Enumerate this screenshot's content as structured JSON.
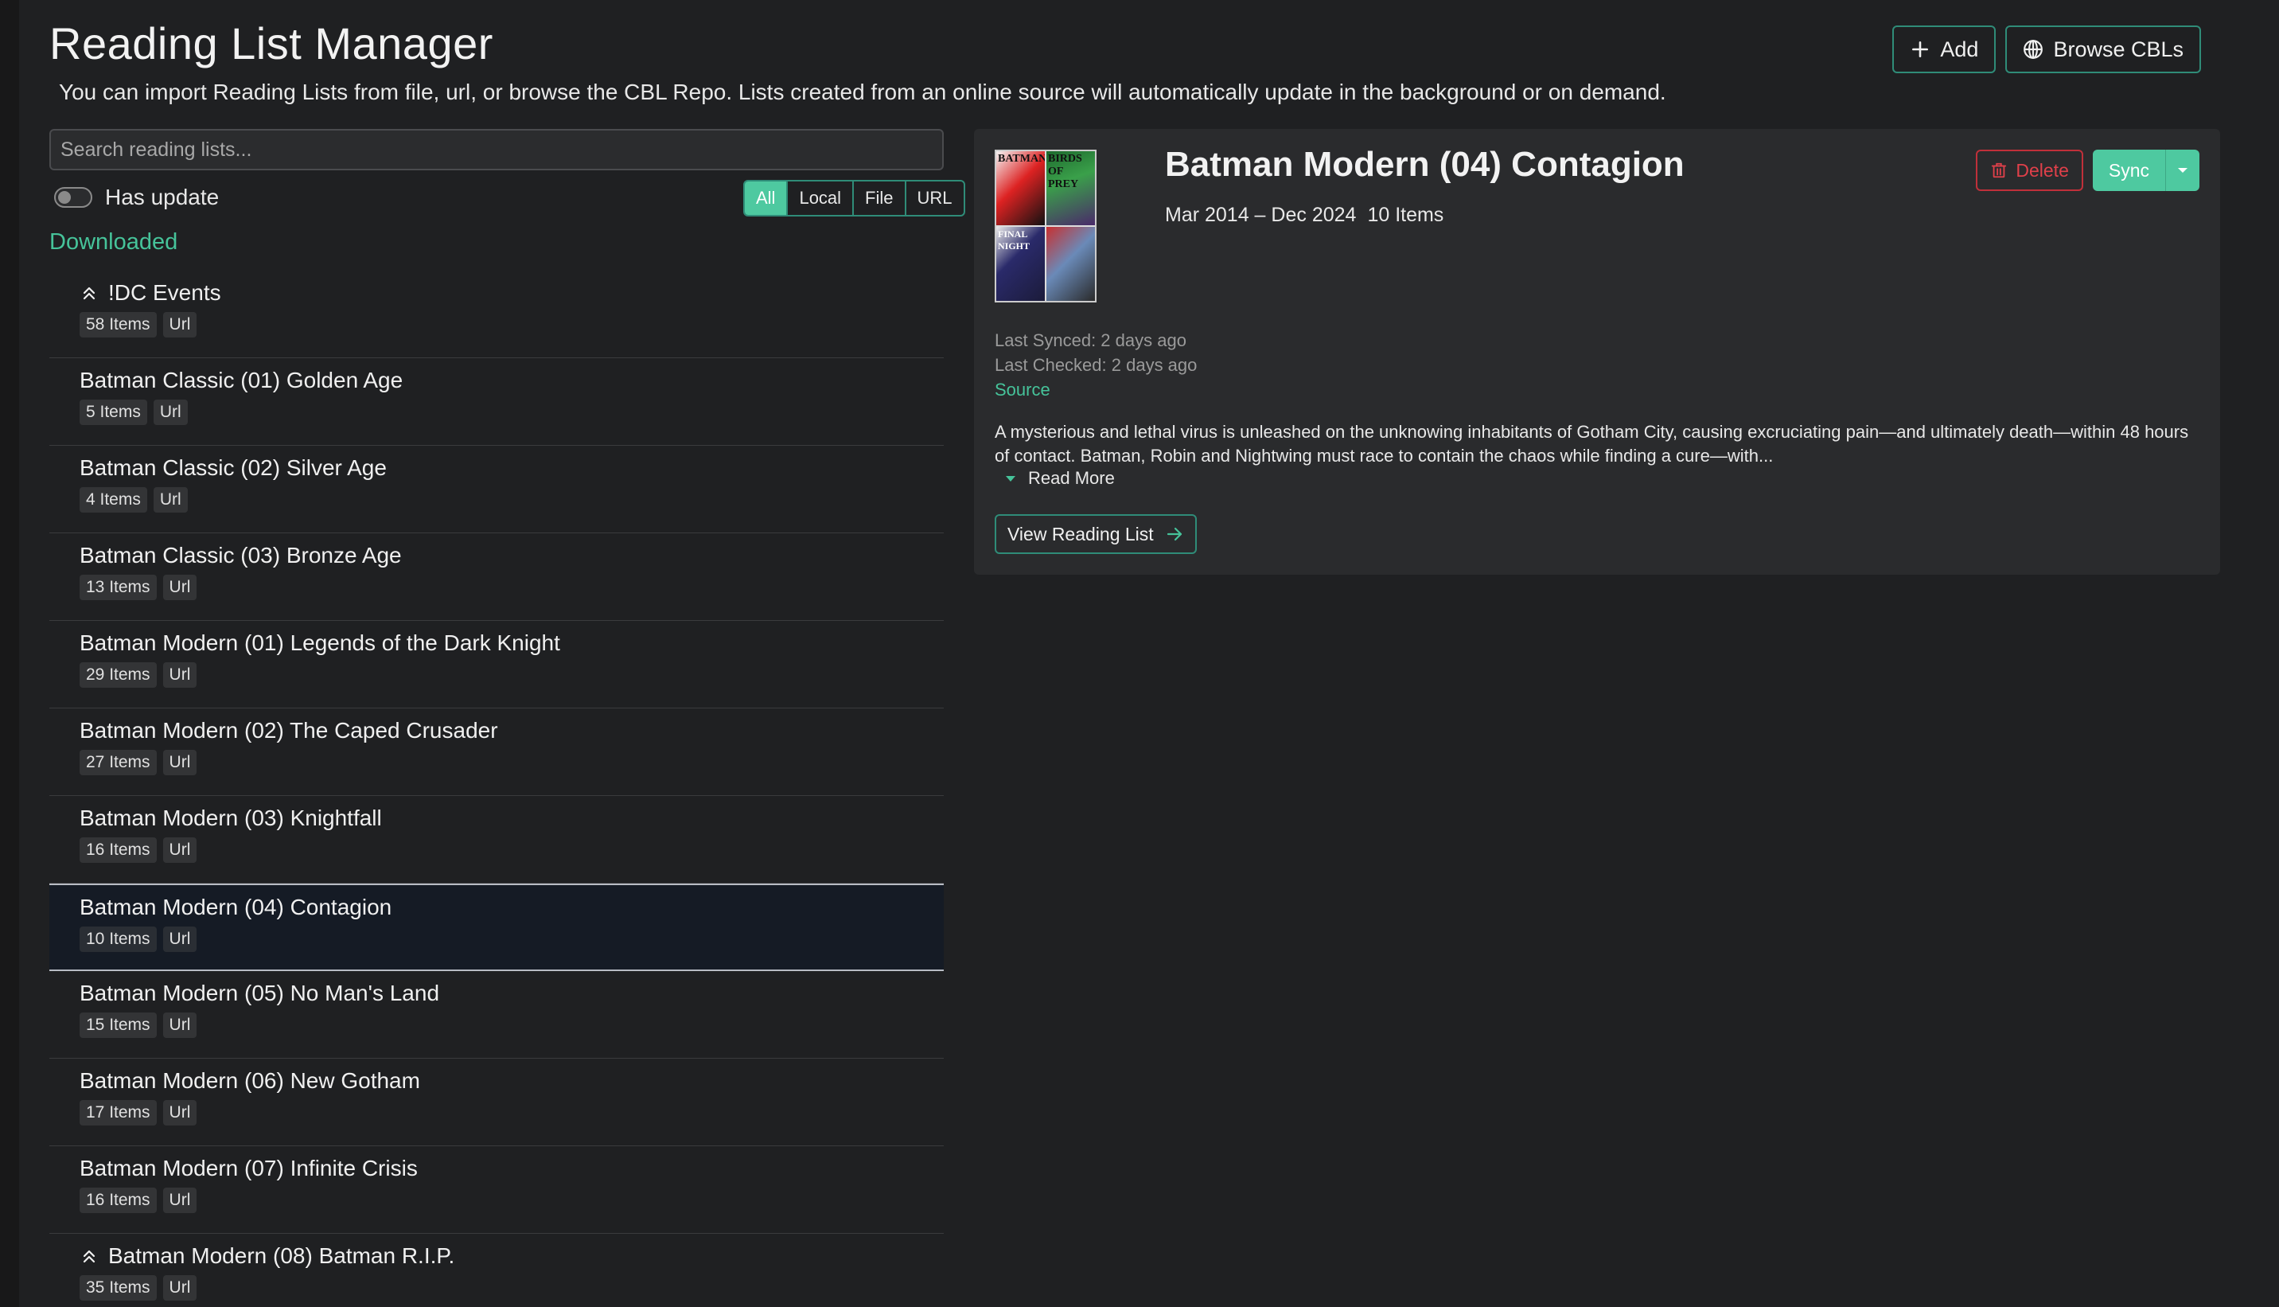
{
  "header": {
    "title": "Reading List Manager",
    "description": "You can import Reading Lists from file, url, or browse the CBL Repo. Lists created from an online source will automatically update in the background or on demand.",
    "add_label": "Add",
    "browse_label": "Browse CBLs"
  },
  "search": {
    "placeholder": "Search reading lists..."
  },
  "filters": {
    "has_update_label": "Has update",
    "has_update_on": false,
    "options": [
      "All",
      "Local",
      "File",
      "URL"
    ],
    "active": "All"
  },
  "section_label": "Downloaded",
  "list": [
    {
      "title": "!DC Events",
      "collapsible": true,
      "count": "58 Items",
      "source": "Url",
      "selected": false
    },
    {
      "title": "Batman Classic (01) Golden Age",
      "collapsible": false,
      "count": "5 Items",
      "source": "Url",
      "selected": false
    },
    {
      "title": "Batman Classic (02) Silver Age",
      "collapsible": false,
      "count": "4 Items",
      "source": "Url",
      "selected": false
    },
    {
      "title": "Batman Classic (03) Bronze Age",
      "collapsible": false,
      "count": "13 Items",
      "source": "Url",
      "selected": false
    },
    {
      "title": "Batman Modern (01) Legends of the Dark Knight",
      "collapsible": false,
      "count": "29 Items",
      "source": "Url",
      "selected": false
    },
    {
      "title": "Batman Modern (02) The Caped Crusader",
      "collapsible": false,
      "count": "27 Items",
      "source": "Url",
      "selected": false
    },
    {
      "title": "Batman Modern (03) Knightfall",
      "collapsible": false,
      "count": "16 Items",
      "source": "Url",
      "selected": false
    },
    {
      "title": "Batman Modern (04) Contagion",
      "collapsible": false,
      "count": "10 Items",
      "source": "Url",
      "selected": true
    },
    {
      "title": "Batman Modern (05) No Man's Land",
      "collapsible": false,
      "count": "15 Items",
      "source": "Url",
      "selected": false
    },
    {
      "title": "Batman Modern (06) New Gotham",
      "collapsible": false,
      "count": "17 Items",
      "source": "Url",
      "selected": false
    },
    {
      "title": "Batman Modern (07) Infinite Crisis",
      "collapsible": false,
      "count": "16 Items",
      "source": "Url",
      "selected": false
    },
    {
      "title": "Batman Modern (08) Batman R.I.P.",
      "collapsible": true,
      "count": "35 Items",
      "source": "Url",
      "selected": false
    }
  ],
  "detail": {
    "title": "Batman Modern (04) Contagion",
    "date_range": "Mar 2014 – Dec 2024",
    "item_count": "10 Items",
    "delete_label": "Delete",
    "sync_label": "Sync",
    "last_synced": "Last Synced: 2 days ago",
    "last_checked": "Last Checked: 2 days ago",
    "source_label": "Source",
    "description": "A mysterious and lethal virus is unleashed on the unknowing inhabitants of Gotham City, causing excruciating pain—and ultimately death—within 48 hours of contact. Batman, Robin and Nightwing must race to contain the chaos while finding a cure—with...",
    "read_more_label": "Read More",
    "view_label": "View Reading List",
    "cover_texts": [
      "BATMAN",
      "BIRDS OF PREY",
      "FINAL NIGHT",
      ""
    ]
  },
  "colors": {
    "accent": "#46c39a",
    "accent_fill": "#4ec9a0",
    "danger": "#e0404a",
    "background": "#1f2022",
    "panel": "#2a2b2d"
  },
  "icons": {
    "add": "plus-icon",
    "browse": "globe-icon",
    "delete": "trash-icon",
    "sync_menu": "caret-down-icon",
    "read_more": "triangle-down-icon",
    "view": "arrow-right-icon",
    "collapsible": "double-chevron-up-icon"
  }
}
